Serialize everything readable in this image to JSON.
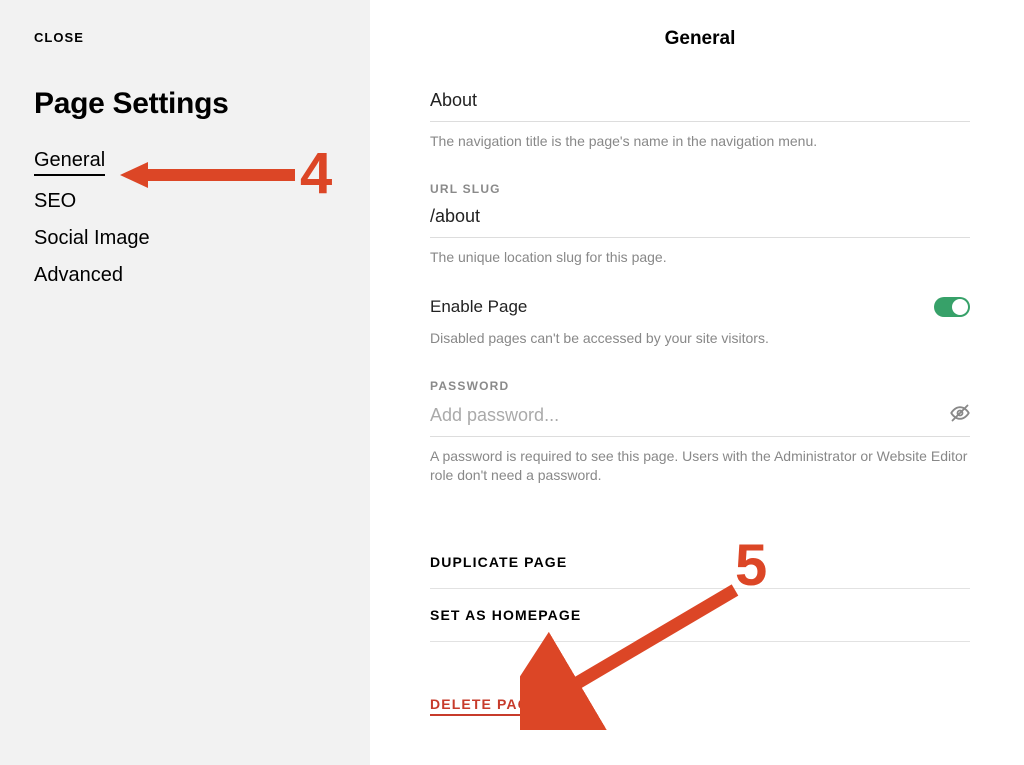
{
  "sidebar": {
    "close_label": "CLOSE",
    "title": "Page Settings",
    "nav": [
      {
        "label": "General",
        "active": true
      },
      {
        "label": "SEO",
        "active": false
      },
      {
        "label": "Social Image",
        "active": false
      },
      {
        "label": "Advanced",
        "active": false
      }
    ]
  },
  "main": {
    "title": "General",
    "nav_title": {
      "value": "About",
      "hint": "The navigation title is the page's name in the navigation menu."
    },
    "url_slug": {
      "label": "URL SLUG",
      "value": "/about",
      "hint": "The unique location slug for this page."
    },
    "enable_page": {
      "label": "Enable Page",
      "enabled": true,
      "hint": "Disabled pages can't be accessed by your site visitors."
    },
    "password": {
      "label": "PASSWORD",
      "placeholder": "Add password...",
      "value": "",
      "hint": "A password is required to see this page. Users with the Administrator or Website Editor role don't need a password."
    },
    "actions": {
      "duplicate": "DUPLICATE PAGE",
      "homepage": "SET AS HOMEPAGE",
      "delete": "DELETE PAGE"
    }
  },
  "annotations": {
    "number_4": "4",
    "number_5": "5"
  }
}
